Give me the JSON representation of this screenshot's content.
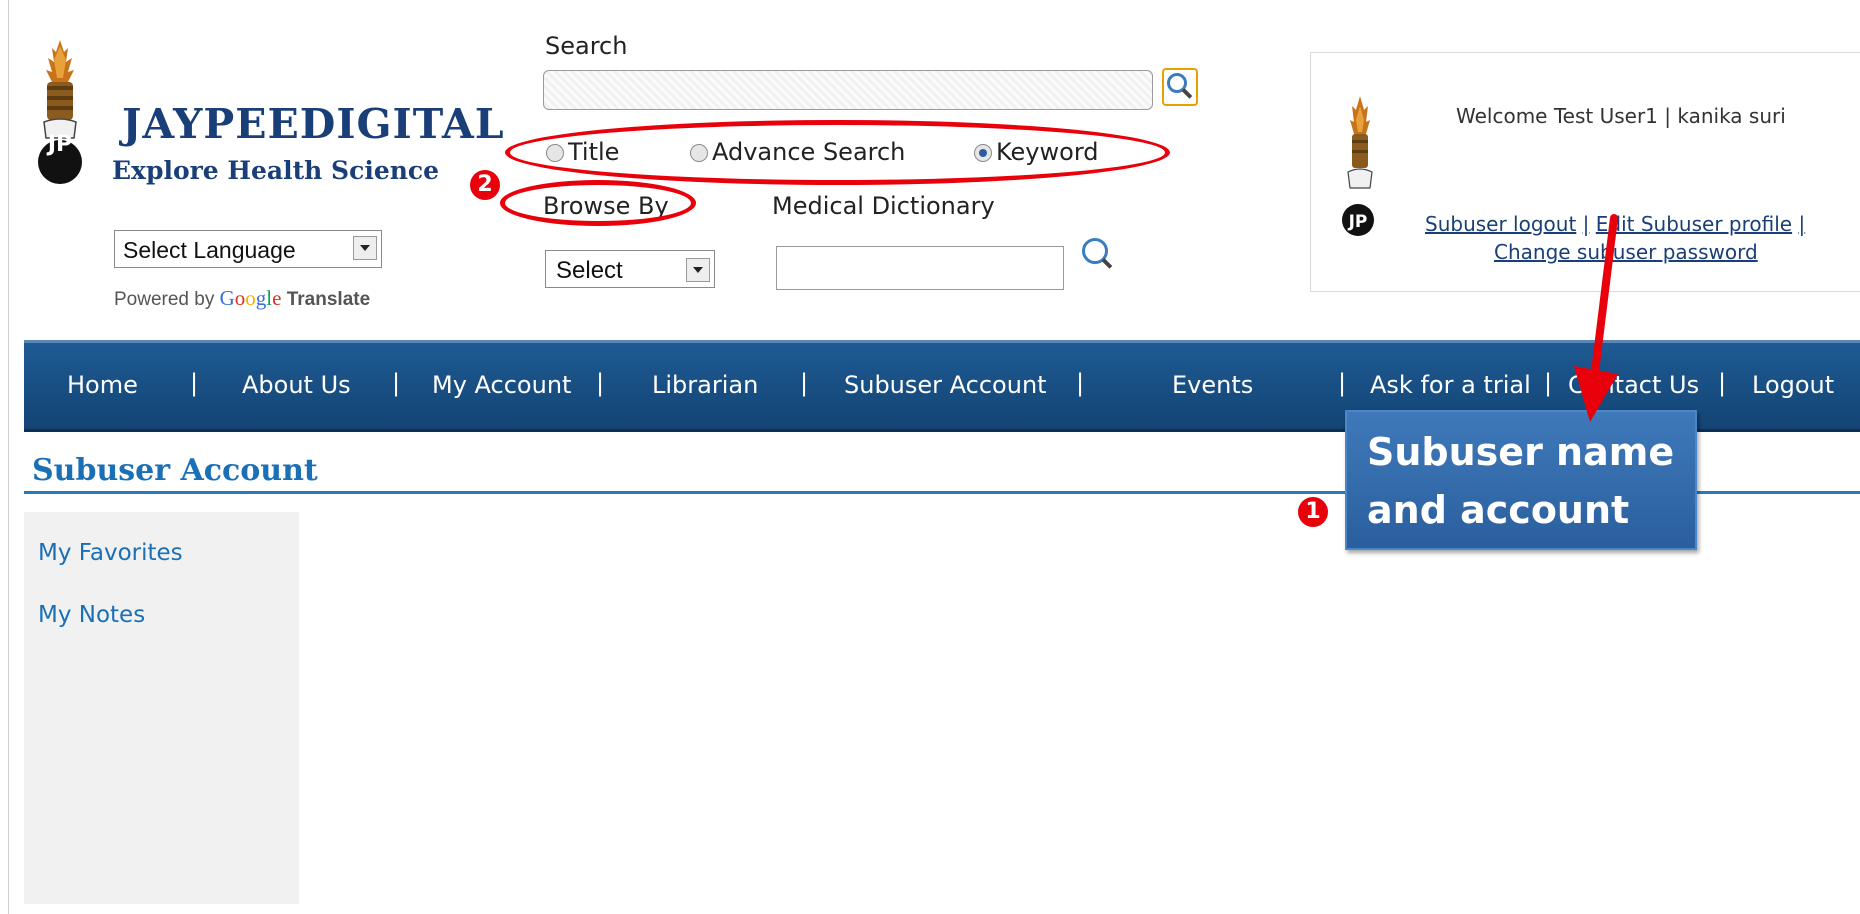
{
  "brand": {
    "name": "JAYPEEDIGITAL",
    "tagline": "Explore Health Science",
    "logo_letters": "JP"
  },
  "language": {
    "select_value": "Select Language",
    "powered_prefix": "Powered by",
    "google": "Google",
    "translate": "Translate"
  },
  "search": {
    "label": "Search",
    "input_value": "",
    "options": [
      {
        "label": "Title",
        "checked": false
      },
      {
        "label": "Advance Search",
        "checked": false
      },
      {
        "label": "Keyword",
        "checked": true
      }
    ]
  },
  "browse": {
    "label": "Browse By",
    "select_value": "Select"
  },
  "dictionary": {
    "label": "Medical Dictionary",
    "input_value": ""
  },
  "user_panel": {
    "welcome": "Welcome Test User1 | kanika suri",
    "links": {
      "logout": "Subuser logout",
      "sep1": "|",
      "edit_profile": "Edit Subuser profile",
      "sep2": "|",
      "change_password": "Change subuser password"
    }
  },
  "nav": {
    "items": [
      "Home",
      "About Us",
      "My Account",
      "Librarian",
      "Subuser Account",
      "Events",
      "Ask for a trial",
      "Contact Us",
      "Logout"
    ],
    "separator": "|"
  },
  "page": {
    "title": "Subuser Account",
    "sidebar_links": [
      "My Favorites",
      "My Notes"
    ]
  },
  "annotations": {
    "callout_line1": "Subuser name",
    "callout_line2": "and account",
    "badge1": "1",
    "badge2": "2"
  },
  "colors": {
    "brand_blue": "#1a3f78",
    "nav_blue": "#1e5a93",
    "link_blue": "#1a6fb5",
    "annotation_red": "#e8000b",
    "callout_blue": "#3f79b9"
  }
}
